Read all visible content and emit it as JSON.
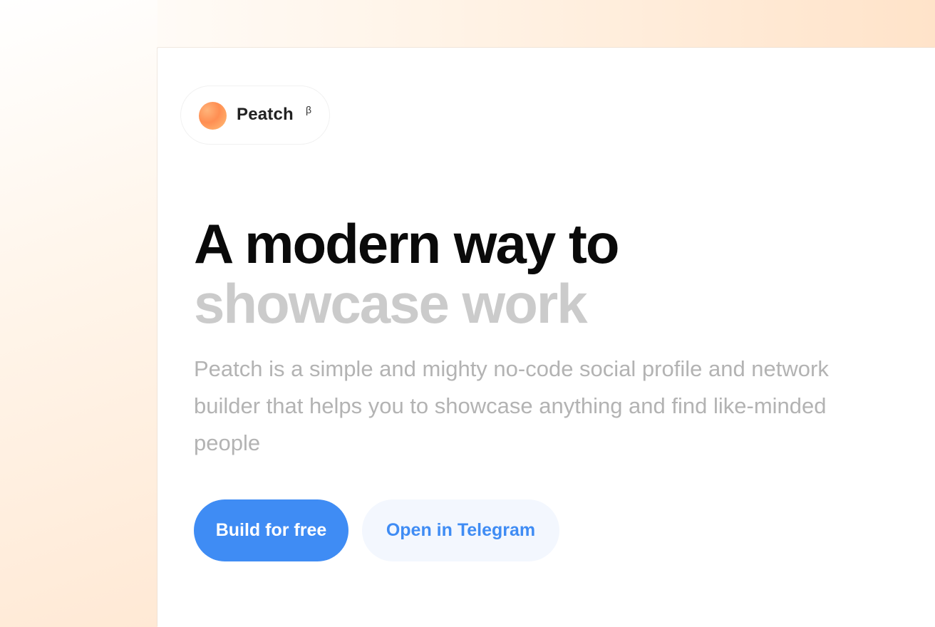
{
  "brand": {
    "name": "Peatch",
    "badge": "β",
    "accent_color": "#ff8e52"
  },
  "hero": {
    "headline_line1": "A modern way to",
    "headline_line2": "showcase work",
    "description": "Peatch is a simple and mighty no-code social profile and network builder that helps you to showcase anything and find like-minded people"
  },
  "actions": {
    "primary_label": "Build for free",
    "secondary_label": "Open in Telegram",
    "primary_color": "#3f8cf4",
    "secondary_bg_color": "#f3f7fe"
  },
  "icons": {
    "logo": "peach-orb-icon"
  }
}
